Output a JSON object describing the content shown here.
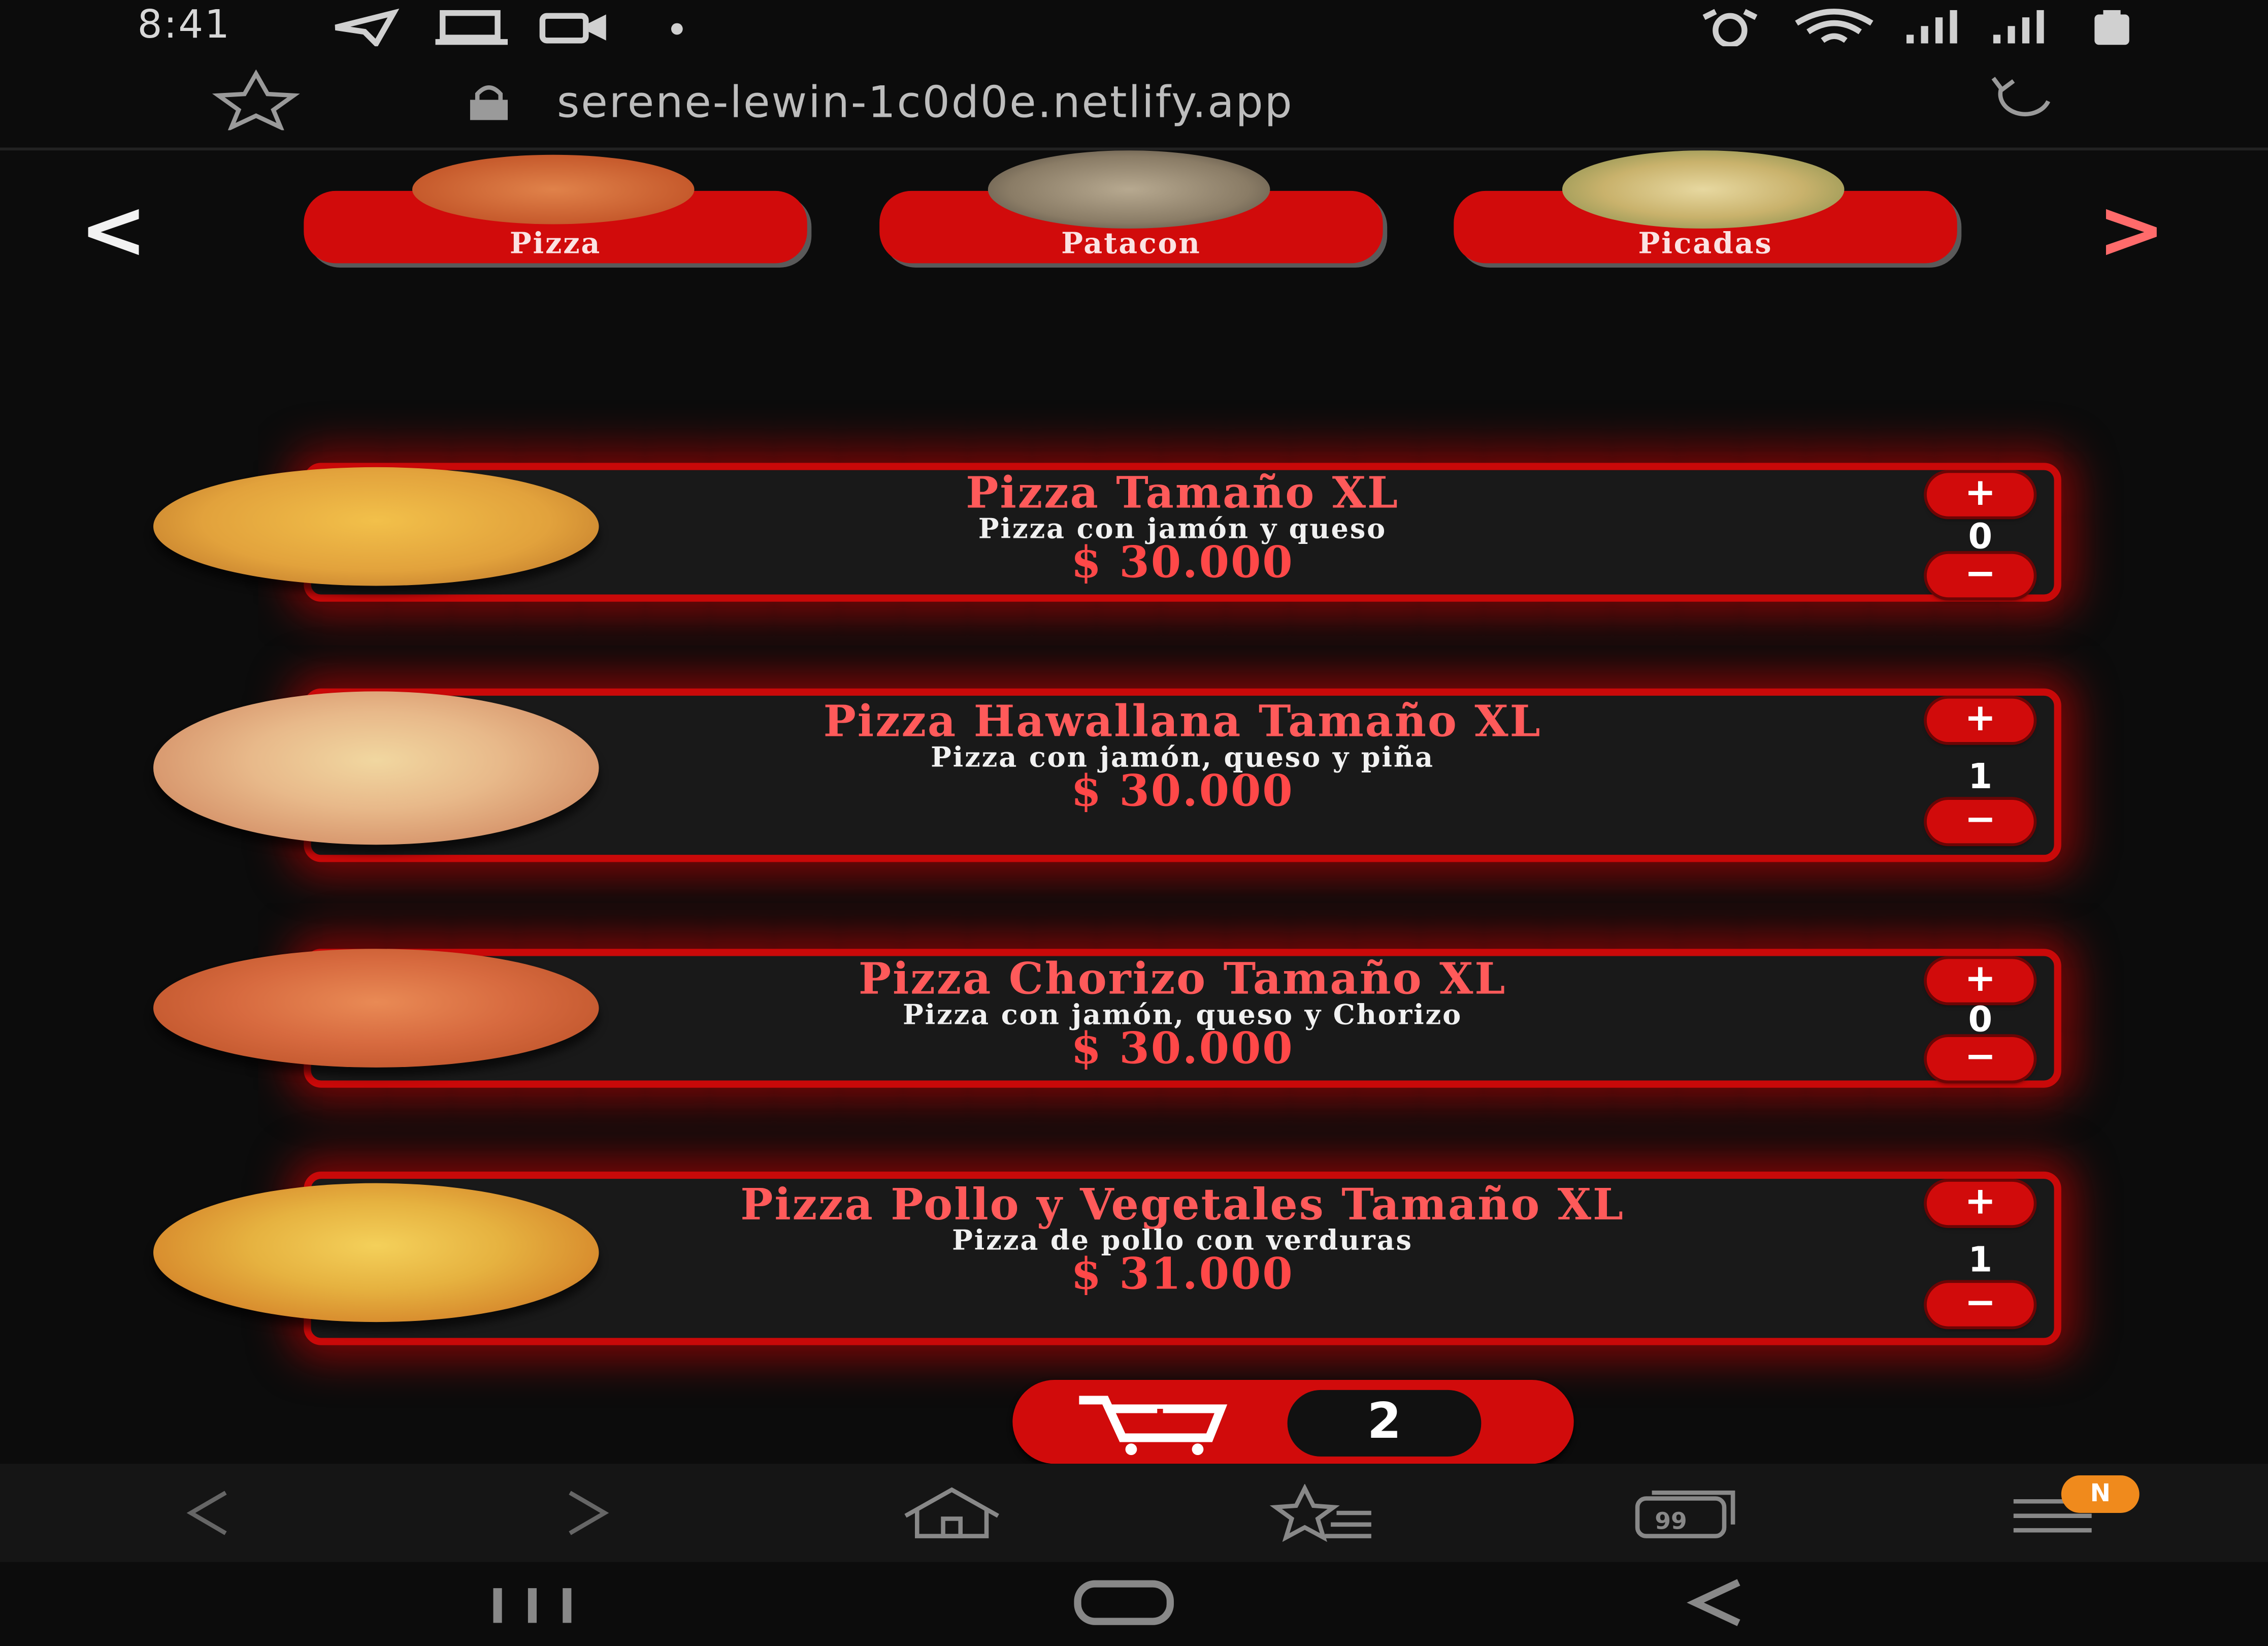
{
  "status_bar": {
    "time": "8:41"
  },
  "browser": {
    "url": "serene-lewin-1c0d0e.netlify.app",
    "menu_badge": "N"
  },
  "categories": [
    {
      "label": "Pizza"
    },
    {
      "label": "Patacon"
    },
    {
      "label": "Picadas"
    }
  ],
  "carousel": {
    "prev": "<",
    "next": ">"
  },
  "products": [
    {
      "title": "Pizza Tamaño XL",
      "description": "Pizza con jamón y queso",
      "price": "$ 30.000",
      "quantity": "0",
      "plus": "+",
      "minus": "−"
    },
    {
      "title": "Pizza Hawallana Tamaño XL",
      "description": "Pizza con jamón, queso y piña",
      "price": "$ 30.000",
      "quantity": "1",
      "plus": "+",
      "minus": "−"
    },
    {
      "title": "Pizza Chorizo Tamaño XL",
      "description": "Pizza con jamón, queso y Chorizo",
      "price": "$ 30.000",
      "quantity": "0",
      "plus": "+",
      "minus": "−"
    },
    {
      "title": "Pizza Pollo y Vegetales Tamaño XL",
      "description": "Pizza de pollo con verduras",
      "price": "$ 31.000",
      "quantity": "1",
      "plus": "+",
      "minus": "−"
    }
  ],
  "cart": {
    "count": "2"
  },
  "icons": {
    "status": [
      "telegram-icon",
      "laptop-icon",
      "video-icon",
      "dot-icon",
      "alarm-icon",
      "wifi-icon",
      "signal-icon",
      "signal-icon",
      "battery-icon"
    ],
    "url_bar": [
      "star-icon",
      "lock-icon",
      "reload-icon"
    ],
    "toolbar": [
      "back-icon",
      "forward-icon",
      "home-icon",
      "bookmarks-icon",
      "tabs-icon",
      "menu-icon"
    ],
    "navbar": [
      "recents-icon",
      "home-button-icon",
      "back-nav-icon"
    ]
  },
  "colors": {
    "accent": "#d10b0b",
    "title_red": "#ff5a5a",
    "price_red": "#ff4848",
    "background": "#0c0c0c"
  }
}
